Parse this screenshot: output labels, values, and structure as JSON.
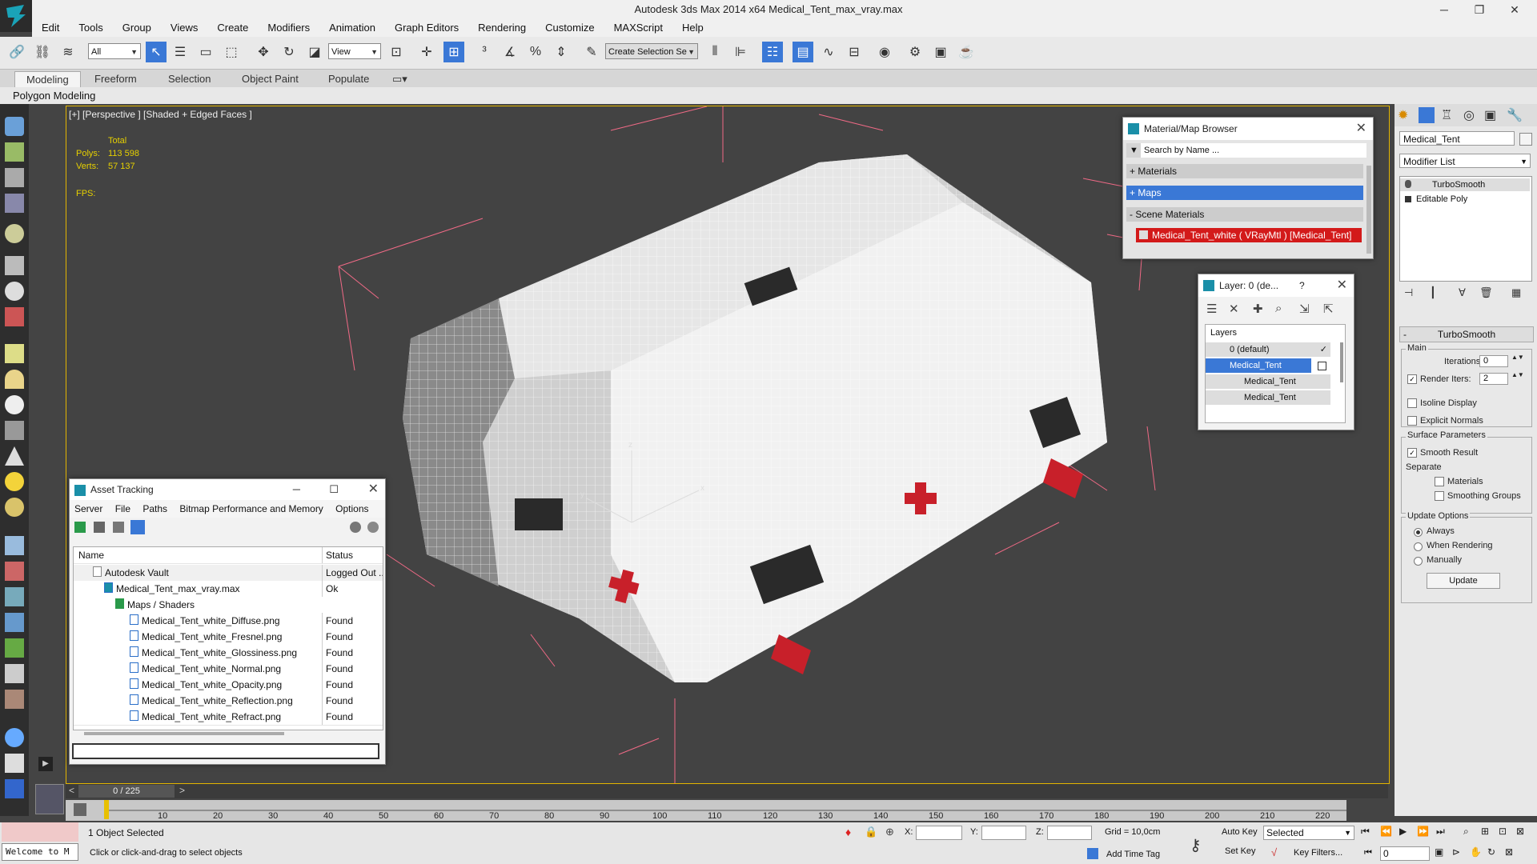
{
  "window": {
    "title": "Autodesk 3ds Max  2014 x64      Medical_Tent_max_vray.max",
    "min": "─",
    "max": "❐",
    "close": "✕"
  },
  "menu": [
    "Edit",
    "Tools",
    "Group",
    "Views",
    "Create",
    "Modifiers",
    "Animation",
    "Graph Editors",
    "Rendering",
    "Customize",
    "MAXScript",
    "Help"
  ],
  "toolbar": {
    "filter_all": "All",
    "ref_coord": "View",
    "selection_set": "Create Selection Se"
  },
  "ribbon": {
    "tabs": [
      "Modeling",
      "Freeform",
      "Selection",
      "Object Paint",
      "Populate"
    ],
    "sub": "Polygon Modeling"
  },
  "viewport": {
    "label": "[+] [Perspective ] [Shaded + Edged Faces ]",
    "stats": {
      "total": "Total",
      "polys_label": "Polys:",
      "polys": "113 598",
      "verts_label": "Verts:",
      "verts": "57 137",
      "fps_label": "FPS:"
    }
  },
  "material_browser": {
    "title": "Material/Map Browser",
    "search": "Search by Name ...",
    "sections": [
      "+ Materials",
      "+ Maps",
      "- Scene Materials"
    ],
    "item": "Medical_Tent_white  ( VRayMtl ) [Medical_Tent]"
  },
  "layer_dialog": {
    "title": "Layer: 0 (de...",
    "help": "?",
    "header": "Layers",
    "items": [
      "0 (default)",
      "Medical_Tent",
      "Medical_Tent",
      "Medical_Tent"
    ]
  },
  "asset_tracking": {
    "title": "Asset Tracking",
    "menu": [
      "Server",
      "File",
      "Paths",
      "Bitmap Performance and Memory",
      "Options"
    ],
    "col_name": "Name",
    "col_status": "Status",
    "rows": [
      {
        "name": "Autodesk Vault",
        "status": "Logged Out ..."
      },
      {
        "name": "Medical_Tent_max_vray.max",
        "status": "Ok"
      },
      {
        "name": "Maps / Shaders",
        "status": ""
      },
      {
        "name": "Medical_Tent_white_Diffuse.png",
        "status": "Found"
      },
      {
        "name": "Medical_Tent_white_Fresnel.png",
        "status": "Found"
      },
      {
        "name": "Medical_Tent_white_Glossiness.png",
        "status": "Found"
      },
      {
        "name": "Medical_Tent_white_Normal.png",
        "status": "Found"
      },
      {
        "name": "Medical_Tent_white_Opacity.png",
        "status": "Found"
      },
      {
        "name": "Medical_Tent_white_Reflection.png",
        "status": "Found"
      },
      {
        "name": "Medical_Tent_white_Refract.png",
        "status": "Found"
      }
    ]
  },
  "command_panel": {
    "object_name": "Medical_Tent",
    "modifier_list": "Modifier List",
    "stack": [
      "TurboSmooth",
      "Editable Poly"
    ],
    "rollout": "TurboSmooth",
    "main": "Main",
    "iterations_label": "Iterations:",
    "iterations": "0",
    "render_iters_label": "Render Iters:",
    "render_iters": "2",
    "isoline": "Isoline Display",
    "explicit": "Explicit Normals",
    "surface": "Surface Parameters",
    "smooth_result": "Smooth Result",
    "separate": "Separate",
    "materials": "Materials",
    "smoothing_groups": "Smoothing Groups",
    "update_options": "Update Options",
    "always": "Always",
    "when_rendering": "When Rendering",
    "manually": "Manually",
    "update_btn": "Update"
  },
  "timeline": {
    "frame": "0 / 225",
    "prev": "<",
    "next": ">"
  },
  "ticks": [
    "10",
    "20",
    "30",
    "40",
    "50",
    "60",
    "70",
    "80",
    "90",
    "100",
    "110",
    "120",
    "130",
    "140",
    "150",
    "160",
    "170",
    "180",
    "190",
    "200",
    "210",
    "220"
  ],
  "status": {
    "welcome": "Welcome to M",
    "selected": "1 Object Selected",
    "hint": "Click or click-and-drag to select objects",
    "x": "X:",
    "y": "Y:",
    "z": "Z:",
    "grid": "Grid = 10,0cm",
    "add_time_tag": "Add Time Tag",
    "auto_key": "Auto Key",
    "set_key": "Set Key",
    "selected_dd": "Selected",
    "key_filters": "Key Filters...",
    "frame_field": "0"
  },
  "colors": {
    "accent": "#3a78d6",
    "viewport_border": "#e3b500",
    "stats": "#e6d000",
    "material_red": "#d31a1a"
  }
}
